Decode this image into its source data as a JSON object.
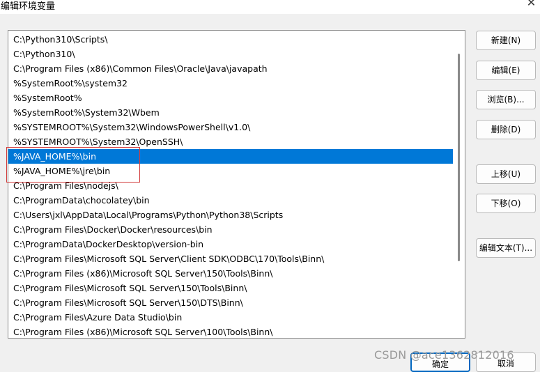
{
  "window": {
    "title": "编辑环境变量",
    "close_glyph": "✕"
  },
  "path_list": {
    "selected_index": 8,
    "highlighted_rows": [
      8,
      9
    ],
    "items": [
      "C:\\Python310\\Scripts\\",
      "C:\\Python310\\",
      "C:\\Program Files (x86)\\Common Files\\Oracle\\Java\\javapath",
      "%SystemRoot%\\system32",
      "%SystemRoot%",
      "%SystemRoot%\\System32\\Wbem",
      "%SYSTEMROOT%\\System32\\WindowsPowerShell\\v1.0\\",
      "%SYSTEMROOT%\\System32\\OpenSSH\\",
      "%JAVA_HOME%\\bin",
      "%JAVA_HOME%\\jre\\bin",
      "C:\\Program Files\\nodejs\\",
      "C:\\ProgramData\\chocolatey\\bin",
      "C:\\Users\\jxl\\AppData\\Local\\Programs\\Python\\Python38\\Scripts",
      "C:\\Program Files\\Docker\\Docker\\resources\\bin",
      "C:\\ProgramData\\DockerDesktop\\version-bin",
      "C:\\Program Files\\Microsoft SQL Server\\Client SDK\\ODBC\\170\\Tools\\Binn\\",
      "C:\\Program Files (x86)\\Microsoft SQL Server\\150\\Tools\\Binn\\",
      "C:\\Program Files\\Microsoft SQL Server\\150\\Tools\\Binn\\",
      "C:\\Program Files\\Microsoft SQL Server\\150\\DTS\\Binn\\",
      "C:\\Program Files\\Azure Data Studio\\bin",
      "C:\\Program Files (x86)\\Microsoft SQL Server\\100\\Tools\\Binn\\"
    ]
  },
  "buttons": {
    "new": "新建(N)",
    "edit": "编辑(E)",
    "browse": "浏览(B)...",
    "delete": "删除(D)",
    "move_up": "上移(U)",
    "move_down": "下移(O)",
    "edit_text": "编辑文本(T)...",
    "ok": "确定",
    "cancel": "取消"
  },
  "watermark": "CSDN @ace1362812016",
  "colors": {
    "selection": "#0078d7",
    "highlight_box": "#d23c3c",
    "primary_border": "#0067c0"
  }
}
